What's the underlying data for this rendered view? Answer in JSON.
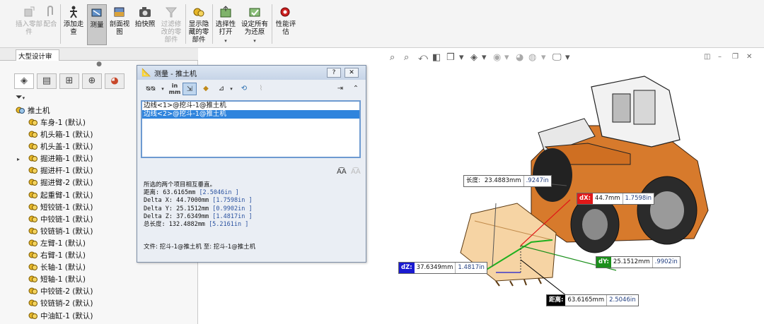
{
  "ribbon": {
    "buttons": [
      {
        "id": "insert-part",
        "label": "插入零部件",
        "disabled": true
      },
      {
        "id": "mate",
        "label": "配合",
        "disabled": true
      },
      {
        "id": "add-walkthrough",
        "label": "添加走查",
        "disabled": false
      },
      {
        "id": "measure",
        "label": "测量",
        "disabled": false,
        "active": true
      },
      {
        "id": "section-view",
        "label": "剖面视图",
        "disabled": false
      },
      {
        "id": "snapshot",
        "label": "拍快照",
        "disabled": false
      },
      {
        "id": "filter-modified",
        "label": "过滤修改的零部件",
        "disabled": true
      },
      {
        "id": "show-hidden",
        "label": "显示隐藏的零部件",
        "disabled": false
      },
      {
        "id": "selective-open",
        "label": "选择性打开",
        "disabled": false
      },
      {
        "id": "set-restore",
        "label": "设定所有为还原",
        "disabled": false
      },
      {
        "id": "perf-eval",
        "label": "性能评估",
        "disabled": false
      }
    ]
  },
  "tabs": {
    "active": "大型设计审阅"
  },
  "tree": {
    "root": "推土机",
    "items": [
      {
        "label": "车身-1 (默认)",
        "expandable": false
      },
      {
        "label": "机头箱-1 (默认)",
        "expandable": false
      },
      {
        "label": "机头盖-1 (默认)",
        "expandable": false
      },
      {
        "label": "掘进箱-1 (默认)",
        "expandable": true
      },
      {
        "label": "掘进杆-1 (默认)",
        "expandable": false
      },
      {
        "label": "掘进臂-2 (默认)",
        "expandable": false
      },
      {
        "label": "起重臂-1 (默认)",
        "expandable": false
      },
      {
        "label": "短铰链-1 (默认)",
        "expandable": false
      },
      {
        "label": "中铰链-1 (默认)",
        "expandable": false
      },
      {
        "label": "铰链销-1 (默认)",
        "expandable": false
      },
      {
        "label": "左臂-1 (默认)",
        "expandable": false
      },
      {
        "label": "右臂-1 (默认)",
        "expandable": false
      },
      {
        "label": "长轴-1 (默认)",
        "expandable": false
      },
      {
        "label": "短轴-1 (默认)",
        "expandable": false
      },
      {
        "label": "中铰链-2 (默认)",
        "expandable": false
      },
      {
        "label": "铰链销-2 (默认)",
        "expandable": false
      },
      {
        "label": "中油缸-1 (默认)",
        "expandable": false
      }
    ]
  },
  "dialog": {
    "title": "测量 - 推土机",
    "help_btn": "?",
    "close_btn": "✕",
    "selections": [
      "边线<1>@挖斗-1@推土机",
      "边线<2>@挖斗-1@推土机"
    ],
    "result_heading": "所选的两个项目相互垂直。",
    "results": [
      {
        "label": "距离:",
        "mm": "63.6165mm",
        "inch": "[2.5046in ]"
      },
      {
        "label": "Delta X:",
        "mm": "44.7000mm",
        "inch": "[1.7598in ]"
      },
      {
        "label": "Delta Y:",
        "mm": "25.1512mm",
        "inch": "[0.9902in ]"
      },
      {
        "label": "Delta Z:",
        "mm": "37.6349mm",
        "inch": "[1.4817in ]"
      },
      {
        "label": "总长度:",
        "mm": "132.4882mm",
        "inch": "[5.2161in ]"
      }
    ],
    "file_line": "文件:  挖斗-1@推土机  至:  挖斗-1@推土机"
  },
  "callouts": [
    {
      "id": "length",
      "tag": "长度:",
      "v1": "23.4883mm",
      "v2": ".9247in",
      "tag_color": "#ffffff",
      "tag_text": "#111111"
    },
    {
      "id": "dx",
      "tag": "dX:",
      "v1": "44.7mm",
      "v2": "1.7598in",
      "tag_color": "#e01818",
      "tag_text": "#ffffff"
    },
    {
      "id": "dy",
      "tag": "dY:",
      "v1": "25.1512mm",
      "v2": ".9902in",
      "tag_color": "#1a8f1a",
      "tag_text": "#ffffff"
    },
    {
      "id": "dz",
      "tag": "dZ:",
      "v1": "37.6349mm",
      "v2": "1.4817in",
      "tag_color": "#1a1ad0",
      "tag_text": "#ffffff"
    },
    {
      "id": "distance",
      "tag": "距离:",
      "v1": "63.6165mm",
      "v2": "2.5046in",
      "tag_color": "#000000",
      "tag_text": "#ffffff"
    }
  ]
}
